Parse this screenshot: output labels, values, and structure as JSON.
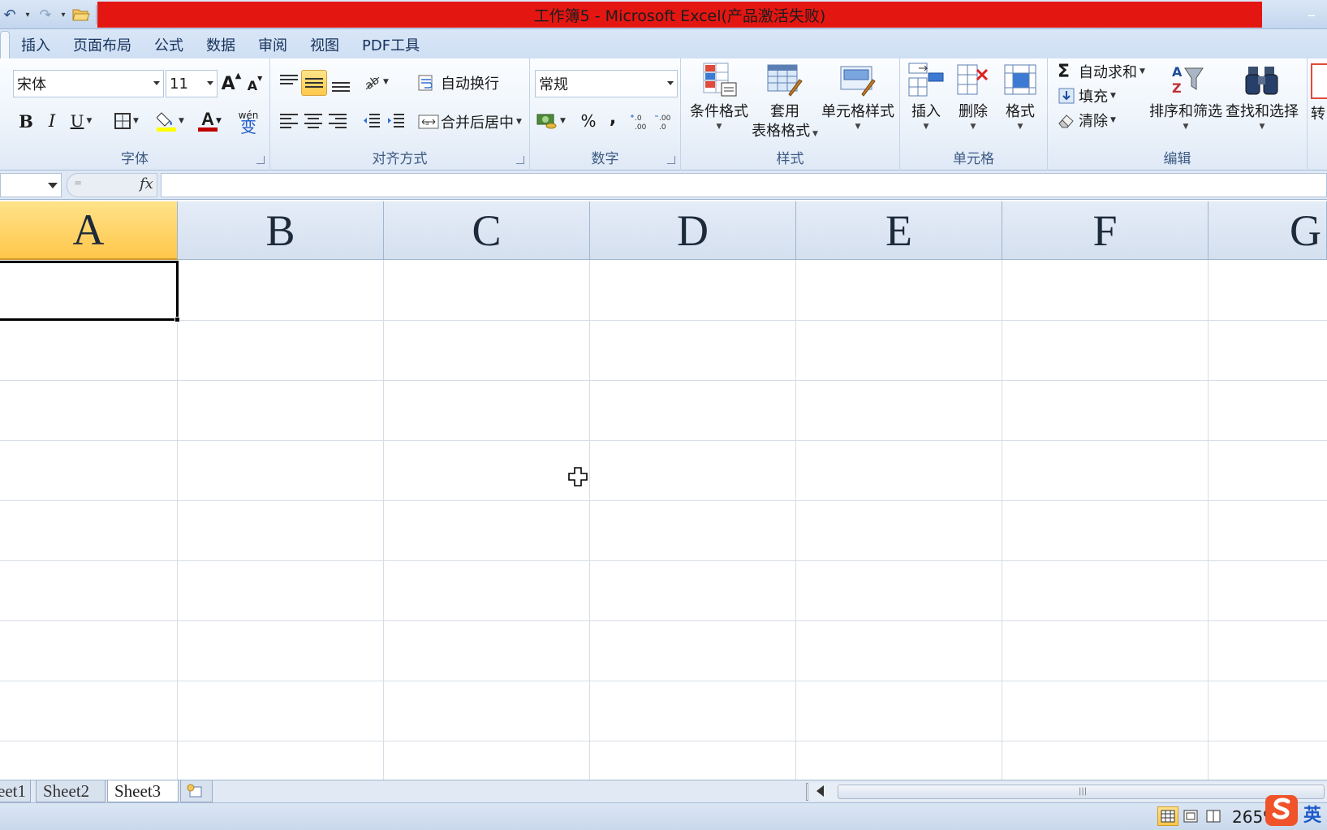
{
  "window": {
    "title": "工作簿5 - Microsoft Excel(产品激活失败)",
    "minimize_glyph": "–"
  },
  "quick_access": {
    "icons": [
      "undo-icon",
      "redo-icon",
      "open-folder-icon",
      "customize-qat-icon"
    ]
  },
  "tabs": [
    "插入",
    "页面布局",
    "公式",
    "数据",
    "审阅",
    "视图",
    "PDF工具"
  ],
  "ribbon": {
    "font_group": {
      "label": "字体",
      "font_name": "宋体",
      "font_size": "11",
      "grow_font": "A",
      "shrink_font": "A",
      "bold": "B",
      "italic": "I",
      "underline": "U",
      "phonetic": "wén",
      "phonetic_char": "变",
      "font_color_letter": "A",
      "font_color": "#c00000",
      "fill_color": "#ffff00"
    },
    "alignment_group": {
      "label": "对齐方式",
      "wrap_text": "自动换行",
      "merge_center": "合并后居中"
    },
    "number_group": {
      "label": "数字",
      "format": "常规",
      "percent": "%",
      "comma": ","
    },
    "styles_group": {
      "label": "样式",
      "conditional": "条件格式",
      "table_format_line1": "套用",
      "table_format_line2": "表格格式",
      "cell_styles": "单元格样式"
    },
    "cells_group": {
      "label": "单元格",
      "insert": "插入",
      "delete": "删除",
      "format": "格式"
    },
    "editing_group": {
      "label": "编辑",
      "autosum": "自动求和",
      "sigma": "Σ",
      "fill": "填充",
      "clear": "清除",
      "sort_filter": "排序和筛选",
      "find_select": "查找和选择",
      "partial": "转"
    }
  },
  "formula_bar": {
    "fx": "fx",
    "value": ""
  },
  "grid": {
    "columns": [
      "A",
      "B",
      "C",
      "D",
      "E",
      "F",
      "G"
    ],
    "selected_column": "A"
  },
  "sheets": {
    "tabs": [
      "eet1",
      "Sheet2",
      "Sheet3"
    ],
    "active": "Sheet3"
  },
  "status": {
    "zoom": "265%",
    "ime_label": "英"
  }
}
